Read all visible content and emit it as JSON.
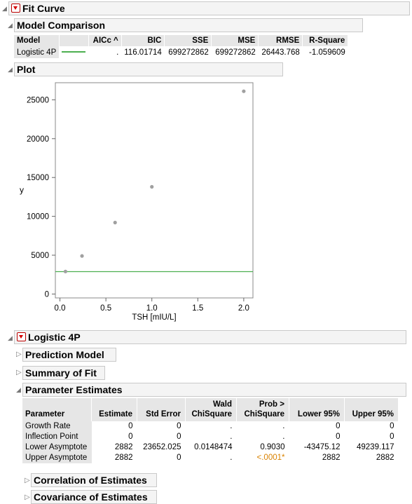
{
  "fit_curve": {
    "title": "Fit Curve"
  },
  "model_comparison": {
    "title": "Model Comparison",
    "columns": [
      "Model",
      "",
      "AICc ^",
      "BIC",
      "SSE",
      "MSE",
      "RMSE",
      "R-Square"
    ],
    "row": {
      "model": "Logistic 4P",
      "aicc": ".",
      "bic": "116.01714",
      "sse": "699272862",
      "mse": "699272862",
      "rmse": "26443.768",
      "rsquare": "-1.059609"
    }
  },
  "plot": {
    "title": "Plot",
    "y_label": "y",
    "x_label": "TSH [mIU/L]"
  },
  "chart_data": {
    "type": "scatter",
    "xlabel": "TSH [mIU/L]",
    "ylabel": "y",
    "xlim": [
      -0.05,
      2.1
    ],
    "ylim": [
      -500,
      27200
    ],
    "x_ticks": [
      "0.0",
      "0.5",
      "1.0",
      "1.5",
      "2.0"
    ],
    "y_ticks": [
      "0",
      "5000",
      "10000",
      "15000",
      "20000",
      "25000"
    ],
    "points": [
      {
        "x": 0.06,
        "y": 2900
      },
      {
        "x": 0.24,
        "y": 4900
      },
      {
        "x": 0.6,
        "y": 9200
      },
      {
        "x": 1.0,
        "y": 13800
      },
      {
        "x": 2.0,
        "y": 26100
      }
    ],
    "fit_line": {
      "name": "Logistic 4P",
      "y": 2882,
      "color": "#4caf50"
    },
    "point_color": "#a0a0a0",
    "grid": false
  },
  "logistic": {
    "title": "Logistic 4P",
    "prediction_model": "Prediction Model",
    "summary_of_fit": "Summary of Fit",
    "parameter_estimates": "Parameter Estimates",
    "correlation": "Correlation of Estimates",
    "covariance": "Covariance of Estimates"
  },
  "param_table": {
    "headers": {
      "parameter": "Parameter",
      "estimate": "Estimate",
      "std_error": "Std Error",
      "wald_1": "Wald",
      "wald_2": "ChiSquare",
      "prob_1": "Prob >",
      "prob_2": "ChiSquare",
      "lower": "Lower 95%",
      "upper": "Upper 95%"
    },
    "rows": [
      {
        "parameter": "Growth Rate",
        "estimate": "0",
        "std_error": "0",
        "wald": ".",
        "prob": ".",
        "lower": "0",
        "upper": "0"
      },
      {
        "parameter": "Inflection Point",
        "estimate": "0",
        "std_error": "0",
        "wald": ".",
        "prob": ".",
        "lower": "0",
        "upper": "0"
      },
      {
        "parameter": "Lower Asymptote",
        "estimate": "2882",
        "std_error": "23652.025",
        "wald": "0.0148474",
        "prob": "0.9030",
        "lower": "-43475.12",
        "upper": "49239.117"
      },
      {
        "parameter": "Upper Asymptote",
        "estimate": "2882",
        "std_error": "0",
        "wald": ".",
        "prob": "<.0001*",
        "lower": "2882",
        "upper": "2882"
      }
    ]
  }
}
